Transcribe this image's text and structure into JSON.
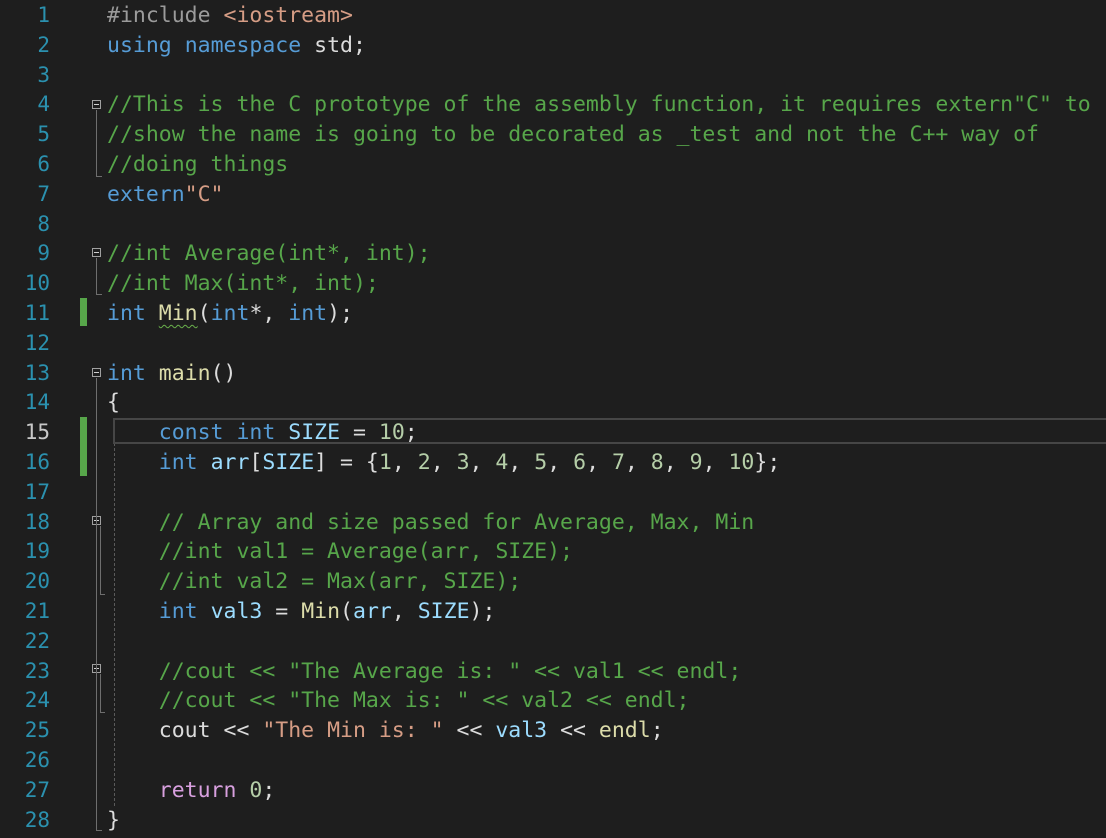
{
  "editor": {
    "lines": [
      {
        "n": "1",
        "tokens": [
          {
            "t": "#include ",
            "c": "inc"
          },
          {
            "t": "<iostream>",
            "c": "st"
          }
        ]
      },
      {
        "n": "2",
        "tokens": [
          {
            "t": "using",
            "c": "kw"
          },
          {
            "t": " "
          },
          {
            "t": "namespace",
            "c": "kw"
          },
          {
            "t": " std;"
          }
        ]
      },
      {
        "n": "3",
        "tokens": []
      },
      {
        "n": "4",
        "tokens": [
          {
            "t": "//This is the C prototype of the assembly function, it requires extern\"C\" to",
            "c": "cm"
          }
        ]
      },
      {
        "n": "5",
        "tokens": [
          {
            "t": "//show the name is going to be decorated as _test and not the C++ way of",
            "c": "cm"
          }
        ]
      },
      {
        "n": "6",
        "tokens": [
          {
            "t": "//doing things",
            "c": "cm"
          }
        ]
      },
      {
        "n": "7",
        "tokens": [
          {
            "t": "extern",
            "c": "kw"
          },
          {
            "t": "\"C\"",
            "c": "st"
          }
        ]
      },
      {
        "n": "8",
        "tokens": []
      },
      {
        "n": "9",
        "tokens": [
          {
            "t": "//int Average(int*, int);",
            "c": "cm"
          }
        ]
      },
      {
        "n": "10",
        "tokens": [
          {
            "t": "//int Max(int*, int);",
            "c": "cm"
          }
        ]
      },
      {
        "n": "11",
        "tokens": [
          {
            "t": "int",
            "c": "kw"
          },
          {
            "t": " "
          },
          {
            "t": "Min",
            "c": "fn squig"
          },
          {
            "t": "("
          },
          {
            "t": "int",
            "c": "kw"
          },
          {
            "t": "*, "
          },
          {
            "t": "int",
            "c": "kw"
          },
          {
            "t": ");"
          }
        ]
      },
      {
        "n": "12",
        "tokens": []
      },
      {
        "n": "13",
        "tokens": [
          {
            "t": "int",
            "c": "kw"
          },
          {
            "t": " "
          },
          {
            "t": "main",
            "c": "fn"
          },
          {
            "t": "()"
          }
        ]
      },
      {
        "n": "14",
        "tokens": [
          {
            "t": "{"
          }
        ]
      },
      {
        "n": "15",
        "tokens": [
          {
            "t": "    "
          },
          {
            "t": "const",
            "c": "kw"
          },
          {
            "t": " "
          },
          {
            "t": "int",
            "c": "kw"
          },
          {
            "t": " "
          },
          {
            "t": "SIZE",
            "c": "var"
          },
          {
            "t": " = "
          },
          {
            "t": "10",
            "c": "num"
          },
          {
            "t": ";"
          }
        ],
        "active": true
      },
      {
        "n": "16",
        "tokens": [
          {
            "t": "    "
          },
          {
            "t": "int",
            "c": "kw"
          },
          {
            "t": " "
          },
          {
            "t": "arr",
            "c": "var"
          },
          {
            "t": "["
          },
          {
            "t": "SIZE",
            "c": "var"
          },
          {
            "t": "] = {"
          },
          {
            "t": "1",
            "c": "num"
          },
          {
            "t": ", "
          },
          {
            "t": "2",
            "c": "num"
          },
          {
            "t": ", "
          },
          {
            "t": "3",
            "c": "num"
          },
          {
            "t": ", "
          },
          {
            "t": "4",
            "c": "num"
          },
          {
            "t": ", "
          },
          {
            "t": "5",
            "c": "num"
          },
          {
            "t": ", "
          },
          {
            "t": "6",
            "c": "num"
          },
          {
            "t": ", "
          },
          {
            "t": "7",
            "c": "num"
          },
          {
            "t": ", "
          },
          {
            "t": "8",
            "c": "num"
          },
          {
            "t": ", "
          },
          {
            "t": "9",
            "c": "num"
          },
          {
            "t": ", "
          },
          {
            "t": "10",
            "c": "num"
          },
          {
            "t": "};"
          }
        ]
      },
      {
        "n": "17",
        "tokens": []
      },
      {
        "n": "18",
        "tokens": [
          {
            "t": "    "
          },
          {
            "t": "// Array and size passed for Average, Max, Min",
            "c": "cm"
          }
        ]
      },
      {
        "n": "19",
        "tokens": [
          {
            "t": "    "
          },
          {
            "t": "//int val1 = Average(arr, SIZE);",
            "c": "cm"
          }
        ]
      },
      {
        "n": "20",
        "tokens": [
          {
            "t": "    "
          },
          {
            "t": "//int val2 = Max(arr, SIZE);",
            "c": "cm"
          }
        ]
      },
      {
        "n": "21",
        "tokens": [
          {
            "t": "    "
          },
          {
            "t": "int",
            "c": "kw"
          },
          {
            "t": " "
          },
          {
            "t": "val3",
            "c": "var"
          },
          {
            "t": " = "
          },
          {
            "t": "Min",
            "c": "fn"
          },
          {
            "t": "("
          },
          {
            "t": "arr",
            "c": "var"
          },
          {
            "t": ", "
          },
          {
            "t": "SIZE",
            "c": "var"
          },
          {
            "t": ");"
          }
        ]
      },
      {
        "n": "22",
        "tokens": []
      },
      {
        "n": "23",
        "tokens": [
          {
            "t": "    "
          },
          {
            "t": "//cout << \"The Average is: \" << val1 << endl;",
            "c": "cm"
          }
        ]
      },
      {
        "n": "24",
        "tokens": [
          {
            "t": "    "
          },
          {
            "t": "//cout << \"The Max is: \" << val2 << endl;",
            "c": "cm"
          }
        ]
      },
      {
        "n": "25",
        "tokens": [
          {
            "t": "    "
          },
          {
            "t": "cout"
          },
          {
            "t": " << "
          },
          {
            "t": "\"The Min is: \"",
            "c": "st"
          },
          {
            "t": " << "
          },
          {
            "t": "val3",
            "c": "var"
          },
          {
            "t": " << "
          },
          {
            "t": "endl",
            "c": "fn"
          },
          {
            "t": ";"
          }
        ]
      },
      {
        "n": "26",
        "tokens": []
      },
      {
        "n": "27",
        "tokens": [
          {
            "t": "    "
          },
          {
            "t": "return",
            "c": "ctl"
          },
          {
            "t": " "
          },
          {
            "t": "0",
            "c": "num"
          },
          {
            "t": ";"
          }
        ]
      },
      {
        "n": "28",
        "tokens": [
          {
            "t": "}"
          }
        ]
      }
    ]
  },
  "colors": {
    "background": "#1e1e1e",
    "line_number": "#2b91af",
    "keyword": "#569cd6",
    "comment": "#57a64a",
    "string": "#d69d85",
    "function": "#dcdcaa",
    "variable": "#9cdcfe",
    "number": "#b5cea8",
    "change_bar": "#57a64a"
  },
  "icons": {
    "fold": "collapse-minus-icon"
  }
}
